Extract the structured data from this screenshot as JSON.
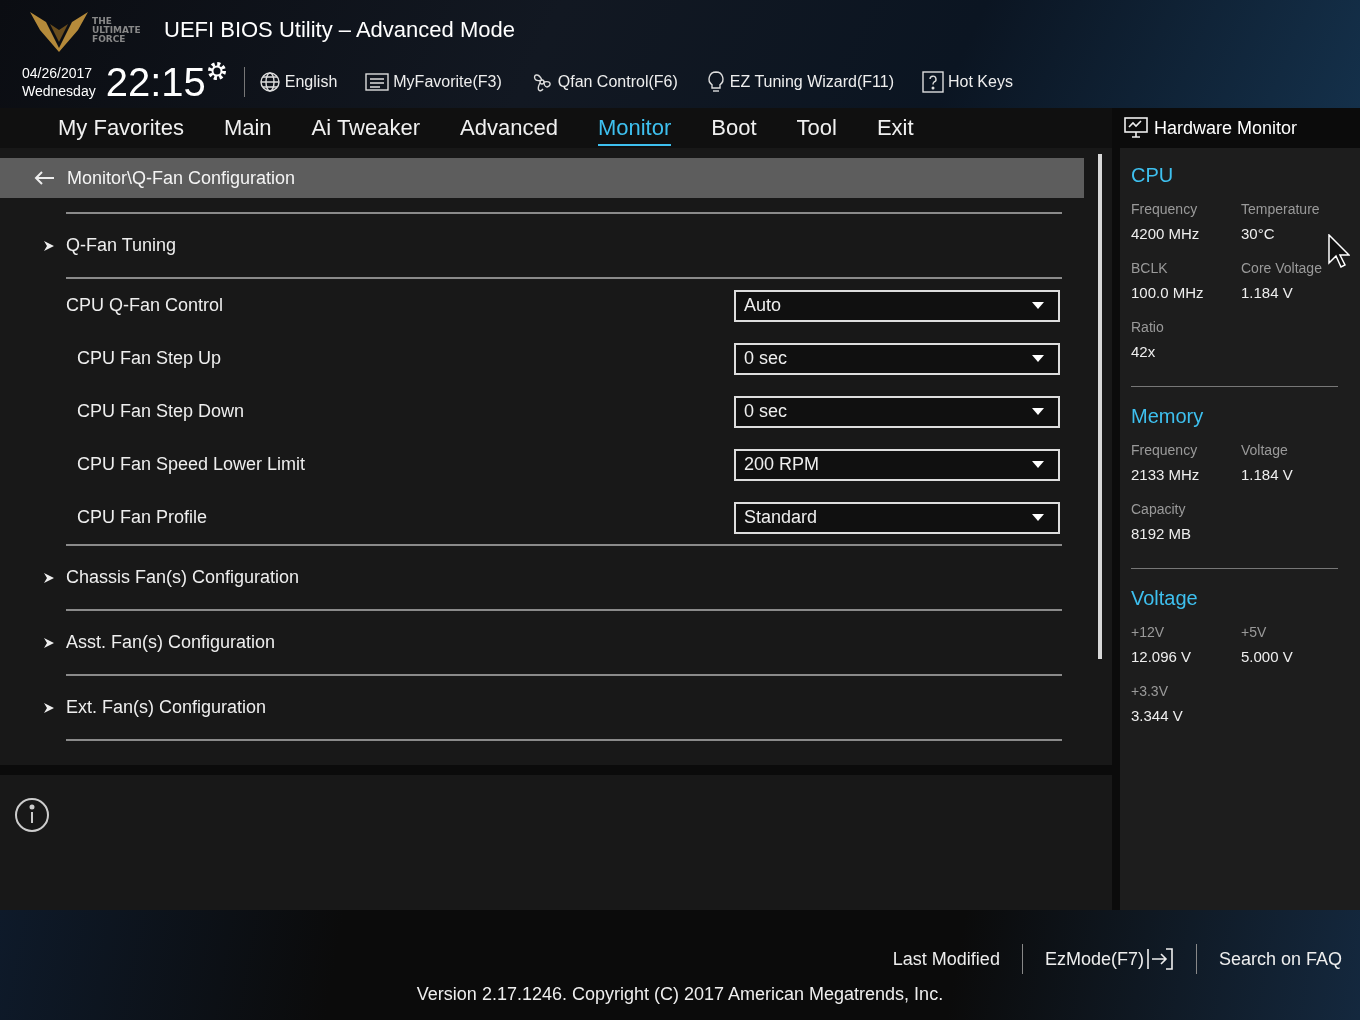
{
  "header": {
    "logo_text": "THE ULTIMATE FORCE",
    "title": "UEFI BIOS Utility – Advanced Mode",
    "date": "04/26/2017",
    "day": "Wednesday",
    "time": "22:15",
    "tools": [
      {
        "kind": "globe",
        "label": "English"
      },
      {
        "kind": "list",
        "label": "MyFavorite(F3)"
      },
      {
        "kind": "fan",
        "label": "Qfan Control(F6)"
      },
      {
        "kind": "bulb",
        "label": "EZ Tuning Wizard(F11)"
      },
      {
        "kind": "help",
        "label": "Hot Keys"
      }
    ]
  },
  "tabs": [
    {
      "label": "My Favorites",
      "selected": false
    },
    {
      "label": "Main",
      "selected": false
    },
    {
      "label": "Ai Tweaker",
      "selected": false
    },
    {
      "label": "Advanced",
      "selected": false
    },
    {
      "label": "Monitor",
      "selected": true
    },
    {
      "label": "Boot",
      "selected": false
    },
    {
      "label": "Tool",
      "selected": false
    },
    {
      "label": "Exit",
      "selected": false
    }
  ],
  "breadcrumb": "Monitor\\Q-Fan Configuration",
  "items": [
    {
      "kind": "submenu",
      "label": "Q-Fan Tuning"
    },
    {
      "kind": "select",
      "label": "CPU Q-Fan Control",
      "value": "Auto",
      "children": [
        {
          "kind": "select",
          "label": "CPU Fan Step Up",
          "value": "0 sec"
        },
        {
          "kind": "select",
          "label": "CPU Fan Step Down",
          "value": "0 sec"
        },
        {
          "kind": "select",
          "label": "CPU Fan Speed Lower Limit",
          "value": "200 RPM"
        },
        {
          "kind": "select",
          "label": "CPU Fan Profile",
          "value": "Standard"
        }
      ]
    },
    {
      "kind": "submenu",
      "label": "Chassis Fan(s) Configuration"
    },
    {
      "kind": "submenu",
      "label": "Asst. Fan(s) Configuration"
    },
    {
      "kind": "submenu",
      "label": "Ext. Fan(s) Configuration"
    }
  ],
  "hardware_monitor": {
    "title": "Hardware Monitor",
    "sections": [
      {
        "title": "CPU",
        "stats": [
          {
            "label": "Frequency",
            "value": "4200 MHz"
          },
          {
            "label": "Temperature",
            "value": "30°C"
          },
          {
            "label": "BCLK",
            "value": "100.0 MHz"
          },
          {
            "label": "Core Voltage",
            "value": "1.184 V"
          },
          {
            "label": "Ratio",
            "value": "42x"
          }
        ]
      },
      {
        "title": "Memory",
        "stats": [
          {
            "label": "Frequency",
            "value": "2133 MHz"
          },
          {
            "label": "Voltage",
            "value": "1.184 V"
          },
          {
            "label": "Capacity",
            "value": "8192 MB"
          }
        ]
      },
      {
        "title": "Voltage",
        "stats": [
          {
            "label": "+12V",
            "value": "12.096 V"
          },
          {
            "label": "+5V",
            "value": "5.000 V"
          },
          {
            "label": "+3.3V",
            "value": "3.344 V"
          }
        ]
      }
    ]
  },
  "footer": {
    "links": [
      {
        "kind": "plain",
        "label": "Last Modified"
      },
      {
        "kind": "exit",
        "label": "EzMode(F7)"
      },
      {
        "kind": "plain",
        "label": "Search on FAQ"
      }
    ],
    "version": "Version 2.17.1246. Copyright (C) 2017 American Megatrends, Inc."
  }
}
